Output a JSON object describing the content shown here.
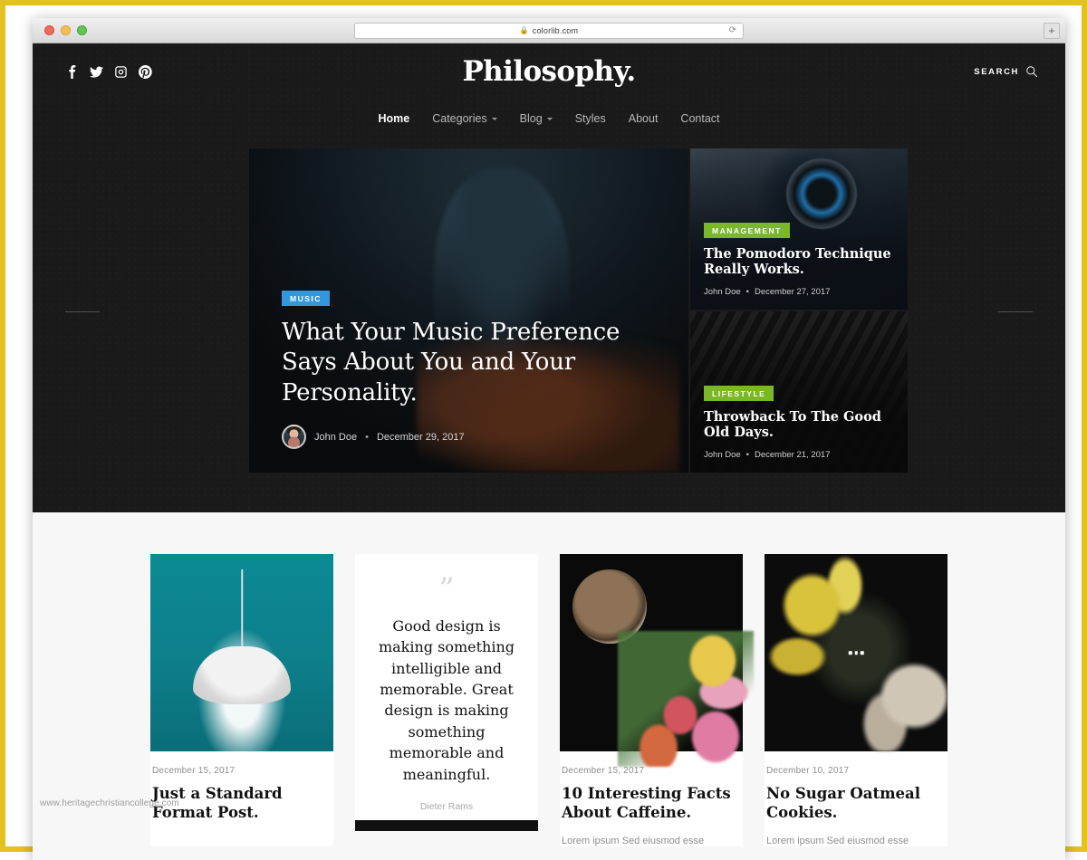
{
  "browser": {
    "url": "colorlib.com",
    "lock_icon": "lock-icon",
    "reload_icon": "reload-icon",
    "newtab_label": "+",
    "traffic_lights": [
      "close-red",
      "minimize-yellow",
      "maximize-green"
    ]
  },
  "site": {
    "brand": "Philosophy.",
    "search_label": "SEARCH",
    "search_icon": "search-icon",
    "social": [
      {
        "name": "facebook-icon",
        "label": "Facebook"
      },
      {
        "name": "twitter-icon",
        "label": "Twitter"
      },
      {
        "name": "instagram-icon",
        "label": "Instagram"
      },
      {
        "name": "pinterest-icon",
        "label": "Pinterest"
      }
    ],
    "nav": [
      {
        "label": "Home",
        "active": true,
        "dropdown": false
      },
      {
        "label": "Categories",
        "active": false,
        "dropdown": true
      },
      {
        "label": "Blog",
        "active": false,
        "dropdown": true
      },
      {
        "label": "Styles",
        "active": false,
        "dropdown": false
      },
      {
        "label": "About",
        "active": false,
        "dropdown": false
      },
      {
        "label": "Contact",
        "active": false,
        "dropdown": false
      }
    ]
  },
  "hero": {
    "featured": {
      "category": "MUSIC",
      "category_color": "#3398db",
      "title": "What Your Music Preference Says About You and Your Personality.",
      "author": "John Doe",
      "separator": "•",
      "date": "December 29, 2017",
      "avatar": "author-avatar"
    },
    "side": [
      {
        "category": "MANAGEMENT",
        "category_color": "#7ab828",
        "title": "The Pomodoro Technique Really Works.",
        "author": "John Doe",
        "separator": "•",
        "date": "December 27, 2017"
      },
      {
        "category": "LIFESTYLE",
        "category_color": "#7ab828",
        "title": "Throwback To The Good Old Days.",
        "author": "John Doe",
        "separator": "•",
        "date": "December 21, 2017"
      }
    ]
  },
  "posts": [
    {
      "type": "standard",
      "image": "pendant-lamp-teal",
      "date": "December 15, 2017",
      "title": "Just a Standard Format Post.",
      "excerpt": ""
    },
    {
      "type": "quote",
      "quote_mark": "”",
      "text": "Good design is making something intelligible and memorable. Great design is making something memorable and meaningful.",
      "author": "Dieter Rams"
    },
    {
      "type": "standard",
      "image": "coffee-and-tulips",
      "date": "December 15, 2017",
      "title": "10 Interesting Facts About Caffeine.",
      "excerpt": "Lorem ipsum Sed eiusmod esse"
    },
    {
      "type": "gallery",
      "image": "flowers-dark-table",
      "gallery_icon": "ellipsis-icon",
      "date": "December 10, 2017",
      "title": "No Sugar Oatmeal Cookies.",
      "excerpt": "Lorem ipsum Sed eiusmod esse"
    }
  ],
  "watermark": "www.heritagechristiancollege.com"
}
